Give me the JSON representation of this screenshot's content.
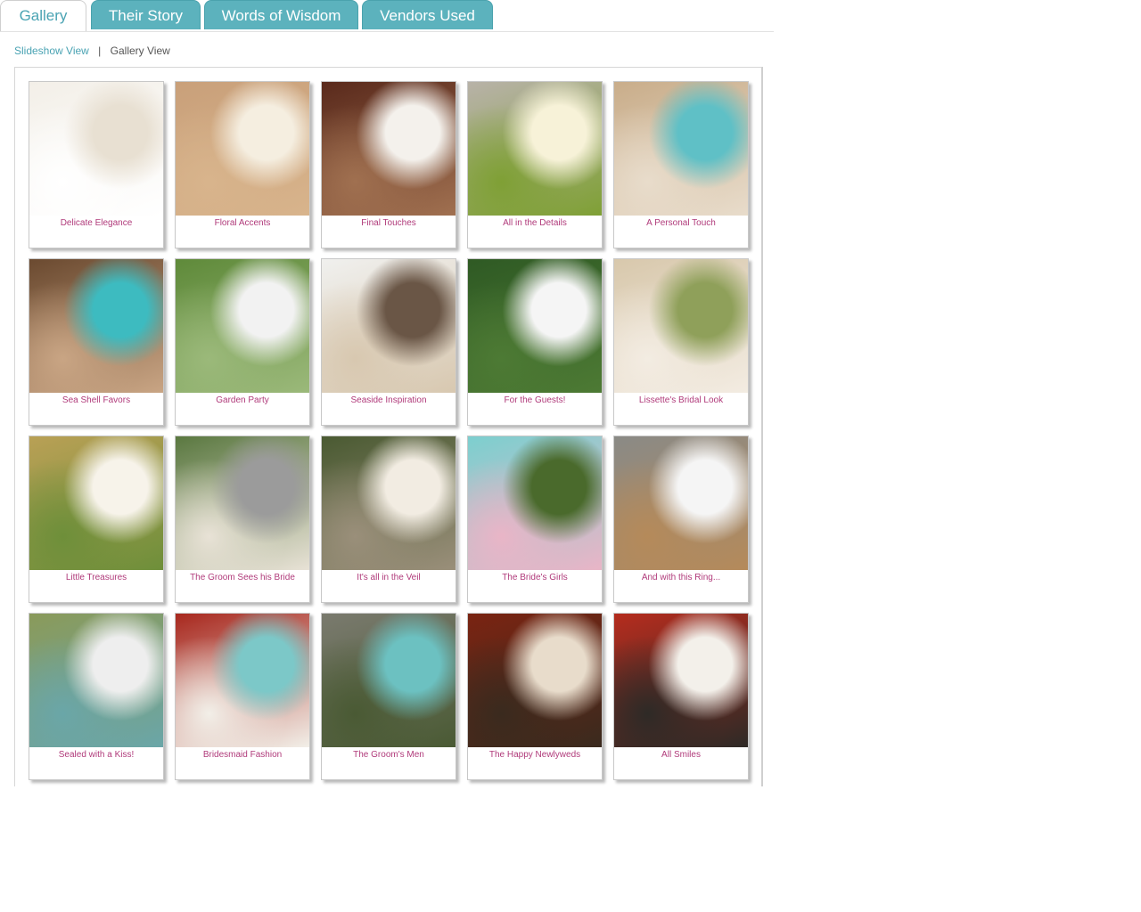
{
  "tabs": [
    {
      "label": "Gallery",
      "active": true
    },
    {
      "label": "Their Story",
      "active": false
    },
    {
      "label": "Words of Wisdom",
      "active": false
    },
    {
      "label": "Vendors Used",
      "active": false
    }
  ],
  "views": {
    "slideshow": "Slideshow View",
    "separator": "|",
    "gallery": "Gallery View"
  },
  "colors": {
    "accent": "#5cb2bd",
    "link": "#4aa3b3",
    "caption": "#b03a7a"
  },
  "gallery": {
    "items": [
      {
        "caption": "Delicate Elegance",
        "palette": [
          "#f3efe8",
          "#e8e0d2",
          "#ffffff"
        ]
      },
      {
        "caption": "Floral Accents",
        "palette": [
          "#c9a07a",
          "#f5eee0",
          "#d8b48c"
        ]
      },
      {
        "caption": "Final Touches",
        "palette": [
          "#5a2a1c",
          "#f4f1ec",
          "#a07050"
        ]
      },
      {
        "caption": "All in the Details",
        "palette": [
          "#b8b2a8",
          "#f7f2d8",
          "#7fa035"
        ]
      },
      {
        "caption": "A Personal Touch",
        "palette": [
          "#c9ad8a",
          "#5fc0c6",
          "#e8dccb"
        ]
      },
      {
        "caption": "Sea Shell Favors",
        "palette": [
          "#6b4a30",
          "#3dbbc0",
          "#c9a584"
        ]
      },
      {
        "caption": "Garden Party",
        "palette": [
          "#5f8a3a",
          "#f2f2f2",
          "#9bb97a"
        ]
      },
      {
        "caption": "Seaside Inspiration",
        "palette": [
          "#f0f0ee",
          "#6a5646",
          "#d8c8b0"
        ]
      },
      {
        "caption": "For the Guests!",
        "palette": [
          "#2f5a24",
          "#f5f5f5",
          "#4d7a34"
        ]
      },
      {
        "caption": "Lissette's Bridal Look",
        "palette": [
          "#d8c8ac",
          "#8fa05a",
          "#f3ece2"
        ]
      },
      {
        "caption": "Little Treasures",
        "palette": [
          "#b9a055",
          "#f7f3ea",
          "#6e8f3a"
        ]
      },
      {
        "caption": "The Groom Sees his Bride",
        "palette": [
          "#5a7840",
          "#9b9b9b",
          "#e8e2d6"
        ]
      },
      {
        "caption": "It's all in the Veil",
        "palette": [
          "#4a5a32",
          "#f2ece2",
          "#9a8f7a"
        ]
      },
      {
        "caption": "The Bride's Girls",
        "palette": [
          "#7ccfcf",
          "#4a6a2c",
          "#e9b5c7"
        ]
      },
      {
        "caption": "And with this Ring...",
        "palette": [
          "#8a8a86",
          "#f5f5f5",
          "#b58a5a"
        ]
      },
      {
        "caption": "Sealed with a Kiss!",
        "palette": [
          "#8a9a5a",
          "#eeeeee",
          "#6aa6a8"
        ]
      },
      {
        "caption": "Bridesmaid Fashion",
        "palette": [
          "#a8281e",
          "#7cc8c8",
          "#f2efe8"
        ]
      },
      {
        "caption": "The Groom's Men",
        "palette": [
          "#7a7a6e",
          "#6cc1c1",
          "#4a5a34"
        ]
      },
      {
        "caption": "The Happy Newlyweds",
        "palette": [
          "#7a2412",
          "#e8dccb",
          "#3a2a1e"
        ]
      },
      {
        "caption": "All Smiles",
        "palette": [
          "#b52c1e",
          "#f3f0ea",
          "#2e2a26"
        ]
      }
    ]
  }
}
